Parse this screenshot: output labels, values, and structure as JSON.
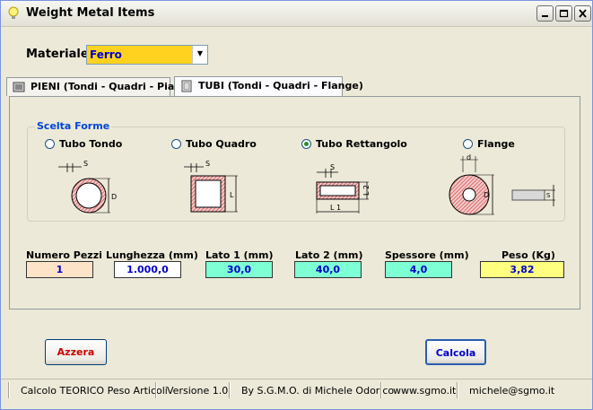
{
  "window": {
    "title": "Weight Metal Items"
  },
  "materiale": {
    "label": "Materiale",
    "value": "Ferro"
  },
  "tabs": [
    {
      "label": "PIENI (Tondi - Quadri - Piatti)"
    },
    {
      "label": "TUBI (Tondi - Quadri - Flange)"
    }
  ],
  "forme": {
    "title": "Scelta Forme",
    "options": [
      {
        "label": "Tubo Tondo",
        "selected": false
      },
      {
        "label": "Tubo Quadro",
        "selected": false
      },
      {
        "label": "Tubo Rettangolo",
        "selected": true
      },
      {
        "label": "Flange",
        "selected": false
      }
    ],
    "diagram_labels": {
      "tondo_s": "S",
      "tondo_d": "D",
      "quadro_s": "S",
      "quadro_l": "L",
      "rett_s": "S",
      "rett_l2": "L 2",
      "rett_l1": "L 1",
      "flange_d_small": "d",
      "flange_d_big": "D",
      "flange_s": "S"
    }
  },
  "fields": {
    "numero_pezzi": {
      "label": "Numero Pezzi",
      "value": "1"
    },
    "lunghezza": {
      "label": "Lunghezza  (mm)",
      "value": "1.000,0"
    },
    "lato1": {
      "label": "Lato 1 (mm)",
      "value": "30,0"
    },
    "lato2": {
      "label": "Lato 2 (mm)",
      "value": "40,0"
    },
    "spessore": {
      "label": "Spessore  (mm)",
      "value": "4,0"
    },
    "peso": {
      "label": "Peso  (Kg)",
      "value": "3,82"
    }
  },
  "buttons": {
    "azzera": "Azzera",
    "calcola": "Calcola"
  },
  "statusbar": [
    "Calcolo TEORICO Peso Articoli",
    "Versione 1.0",
    "By S.G.M.O. di Michele Odorico",
    "www.sgmo.it",
    "michele@sgmo.it"
  ],
  "colors": {
    "materiale_bg": "#ffd21f",
    "value_text": "#0000cc",
    "pezzi_bg": "#fde4c8",
    "lunghezza_bg": "#ffffff",
    "dim_bg": "#7fffd4",
    "peso_bg": "#ffff80",
    "azzera_text": "#cc0000",
    "calcola_text": "#0000cc",
    "group_title": "#0046d5"
  }
}
